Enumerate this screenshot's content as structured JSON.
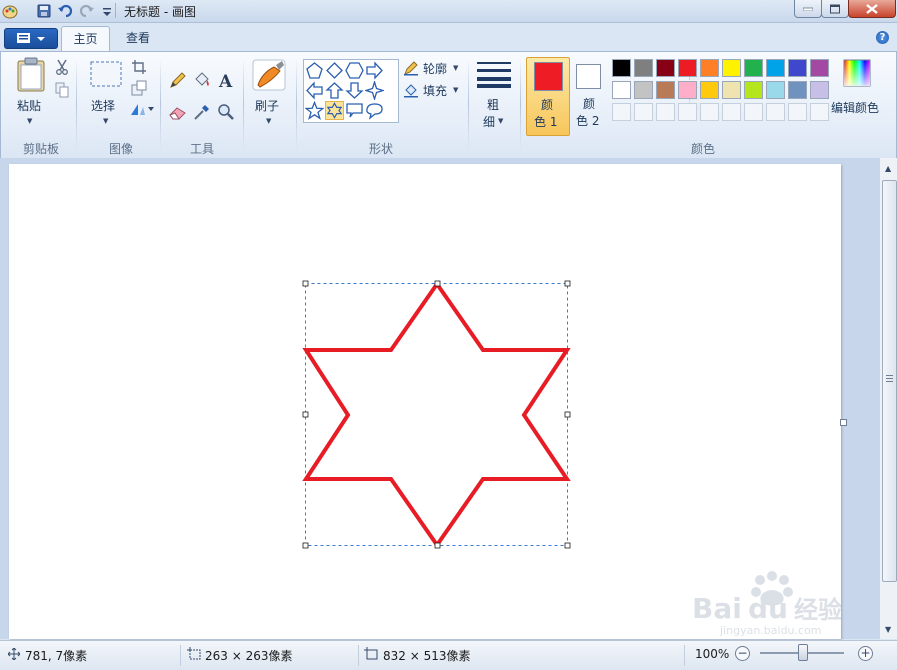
{
  "window": {
    "title": "无标题 - 画图"
  },
  "tabs": [
    {
      "label": "主页",
      "active": true
    },
    {
      "label": "查看",
      "active": false
    }
  ],
  "ribbon": {
    "clipboard": {
      "paste_label": "粘贴",
      "group_label": "剪贴板"
    },
    "image": {
      "select_label": "选择",
      "group_label": "图像"
    },
    "tools": {
      "group_label": "工具"
    },
    "brushes": {
      "label": "刷子"
    },
    "shapes": {
      "outline_label": "轮廓",
      "fill_label": "填充",
      "group_label": "形状"
    },
    "size": {
      "label_line1": "粗",
      "label_line2": "细"
    },
    "colors": {
      "color1_line1": "颜",
      "color1_line2": "色 1",
      "color1_value": "#ee1c24",
      "color2_line1": "颜",
      "color2_line2": "色 2",
      "color2_value": "#ffffff",
      "edit_label": "编辑颜色",
      "group_label": "颜色",
      "palette_row1": [
        "#000000",
        "#7f7f7f",
        "#880015",
        "#ed1c24",
        "#ff7f27",
        "#fff200",
        "#22b14c",
        "#00a2e8",
        "#3f48cc",
        "#a349a4"
      ],
      "palette_row2": [
        "#ffffff",
        "#c3c3c3",
        "#b97a57",
        "#ffaec9",
        "#ffc90e",
        "#efe4b0",
        "#b5e61d",
        "#99d9ea",
        "#7092be",
        "#c8bfe7"
      ],
      "palette_row3_count": 10
    }
  },
  "canvas": {
    "star_color": "#e81c24"
  },
  "statusbar": {
    "cursor_pos": "781, 7像素",
    "selection_size": "263 × 263像素",
    "image_size": "832 × 513像素",
    "zoom": "100%"
  }
}
